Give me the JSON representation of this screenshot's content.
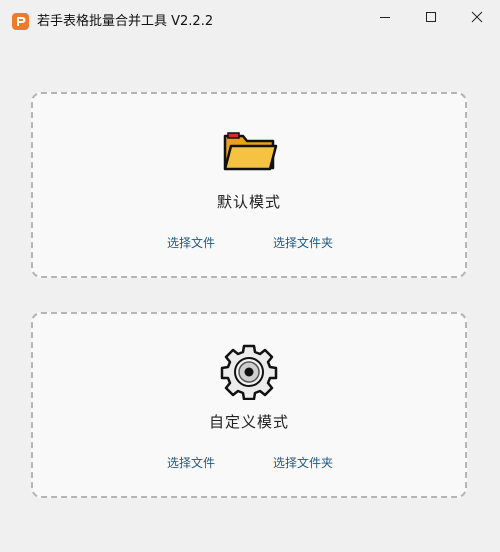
{
  "window": {
    "title": "若手表格批量合并工具 V2.2.2",
    "controls": [
      "minimize-icon",
      "maximize-icon",
      "close-icon"
    ]
  },
  "cards": {
    "default": {
      "icon": "folder-icon",
      "title": "默认模式",
      "select_file": "选择文件",
      "select_folder": "选择文件夹"
    },
    "custom": {
      "icon": "gear-icon",
      "title": "自定义模式",
      "select_file": "选择文件",
      "select_folder": "选择文件夹"
    }
  },
  "colors": {
    "background": "#f0f0f0",
    "card_background": "#f9f9f9",
    "card_border": "#b5b5b5",
    "link": "#1d5a8c",
    "app_icon": "#f07a2a",
    "folder": "#f5c242"
  }
}
